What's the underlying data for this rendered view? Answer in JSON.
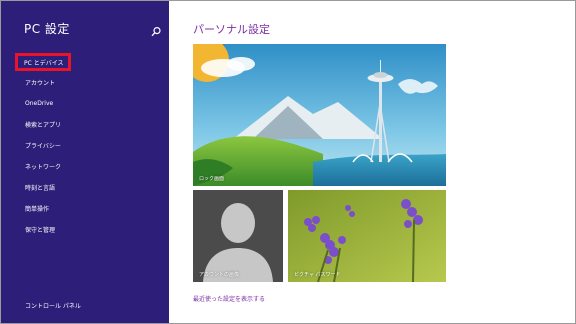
{
  "sidebar": {
    "title": "PC 設定",
    "search_icon": "search-icon",
    "items": [
      {
        "label": "PC とデバイス",
        "selected": true
      },
      {
        "label": "アカウント"
      },
      {
        "label": "OneDrive"
      },
      {
        "label": "検索とアプリ"
      },
      {
        "label": "プライバシー"
      },
      {
        "label": "ネットワーク"
      },
      {
        "label": "時刻と言語"
      },
      {
        "label": "簡単操作"
      },
      {
        "label": "保守と管理"
      }
    ],
    "footer_link": "コントロール パネル",
    "background": "#2d1f79",
    "selection_color": "#e8142a"
  },
  "main": {
    "title": "パーソナル設定",
    "accent": "#7b2ea6",
    "tiles": {
      "lock_screen": {
        "label": "ロック画面"
      },
      "account_picture": {
        "label": "アカウントの画像"
      },
      "picture_password": {
        "label": "ピクチャ パスワード"
      }
    },
    "recent_link": "最近使った設定を表示する"
  }
}
